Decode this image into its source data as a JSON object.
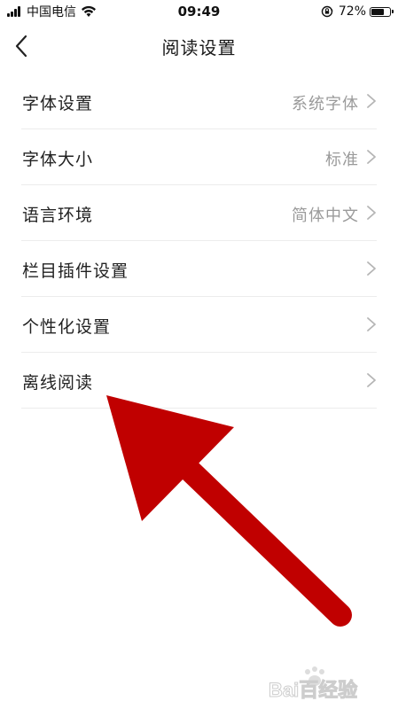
{
  "status_bar": {
    "carrier": "中国电信",
    "time": "09:49",
    "battery_percent": "72%",
    "battery_level": 0.72,
    "icons": [
      "signal-icon",
      "wifi-icon",
      "orientation-lock-icon",
      "battery-icon"
    ]
  },
  "nav": {
    "title": "阅读设置",
    "back_icon": "chevron-left-icon"
  },
  "settings": {
    "items": [
      {
        "label": "字体设置",
        "value": "系统字体"
      },
      {
        "label": "字体大小",
        "value": "标准"
      },
      {
        "label": "语言环境",
        "value": "简体中文"
      },
      {
        "label": "栏目插件设置",
        "value": ""
      },
      {
        "label": "个性化设置",
        "value": ""
      },
      {
        "label": "离线阅读",
        "value": ""
      }
    ],
    "chevron_icon": "chevron-right-icon"
  },
  "annotation": {
    "arrow_color": "#c00000"
  },
  "watermark": {
    "text": "Bai百经验"
  },
  "colors": {
    "label": "#222222",
    "value": "#9a9a9a",
    "divider": "#ececec",
    "background": "#ffffff"
  }
}
